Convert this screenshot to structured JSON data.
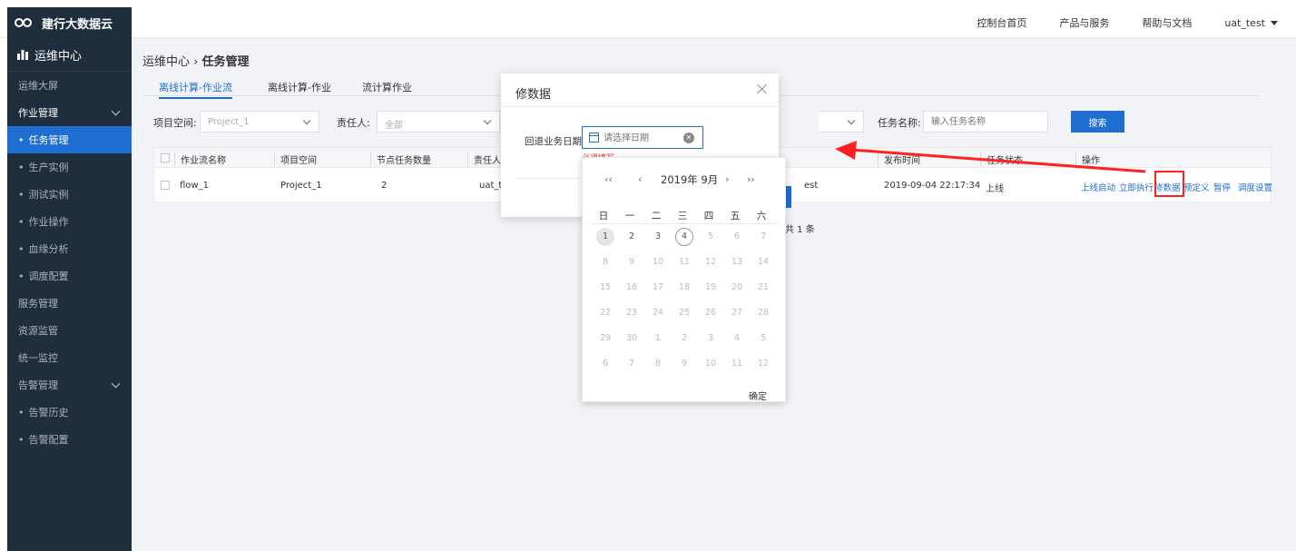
{
  "brand": {
    "name": "建行大数据云"
  },
  "topnav": {
    "console": "控制台首页",
    "products": "产品与服务",
    "help": "帮助与文档",
    "user": "uat_test"
  },
  "sidebar": {
    "header": "运维中心",
    "items": [
      {
        "label": "运维大屏"
      },
      {
        "label": "作业管理"
      },
      {
        "label": "任务管理"
      },
      {
        "label": "生产实例"
      },
      {
        "label": "测试实例"
      },
      {
        "label": "作业操作"
      },
      {
        "label": "血缘分析"
      },
      {
        "label": "调度配置"
      },
      {
        "label": "服务管理"
      },
      {
        "label": "资源监管"
      },
      {
        "label": "统一监控"
      },
      {
        "label": "告警管理"
      },
      {
        "label": "告警历史"
      },
      {
        "label": "告警配置"
      }
    ]
  },
  "breadcrumb": {
    "parent": "运维中心",
    "sep": "›",
    "current": "任务管理"
  },
  "tabs": [
    "离线计算-作业流",
    "离线计算-作业",
    "流计算作业"
  ],
  "filters": {
    "project_label": "项目空间:",
    "project_value": "Project_1",
    "owner_label": "责任人:",
    "owner_value": "全部",
    "task_name_label": "任务名称:",
    "task_name_placeholder": "输入任务名称",
    "search_label": "搜索"
  },
  "table": {
    "headers": [
      "作业流名称",
      "项目空间",
      "节点任务数量",
      "责任人",
      "发布时间",
      "任务状态",
      "操作"
    ],
    "row": {
      "name": "flow_1",
      "project": "Project_1",
      "node_count": "2",
      "owner": "uat_t",
      "owner_tail": "est",
      "publish_time": "2019-09-04 22:17:34",
      "status": "上线",
      "ops": [
        "上线启动",
        "立即执行",
        "修数据",
        "预定义",
        "暂停",
        "调度设置"
      ]
    },
    "total": "共 1 条"
  },
  "modal": {
    "title": "修数据",
    "date_label": "回退业务日期:",
    "date_placeholder": "请选择日期",
    "error_text": "必须填写"
  },
  "calendar": {
    "title": "2019年 9月",
    "prev_year": "‹‹",
    "prev_month": "‹",
    "next_month": "›",
    "next_year": "››",
    "weekdays": [
      "日",
      "一",
      "二",
      "三",
      "四",
      "五",
      "六"
    ],
    "confirm": "确定"
  },
  "colors": {
    "accent": "#1e6fd1",
    "sidebar": "#1f2d3d",
    "highlight": "#ff2020"
  }
}
